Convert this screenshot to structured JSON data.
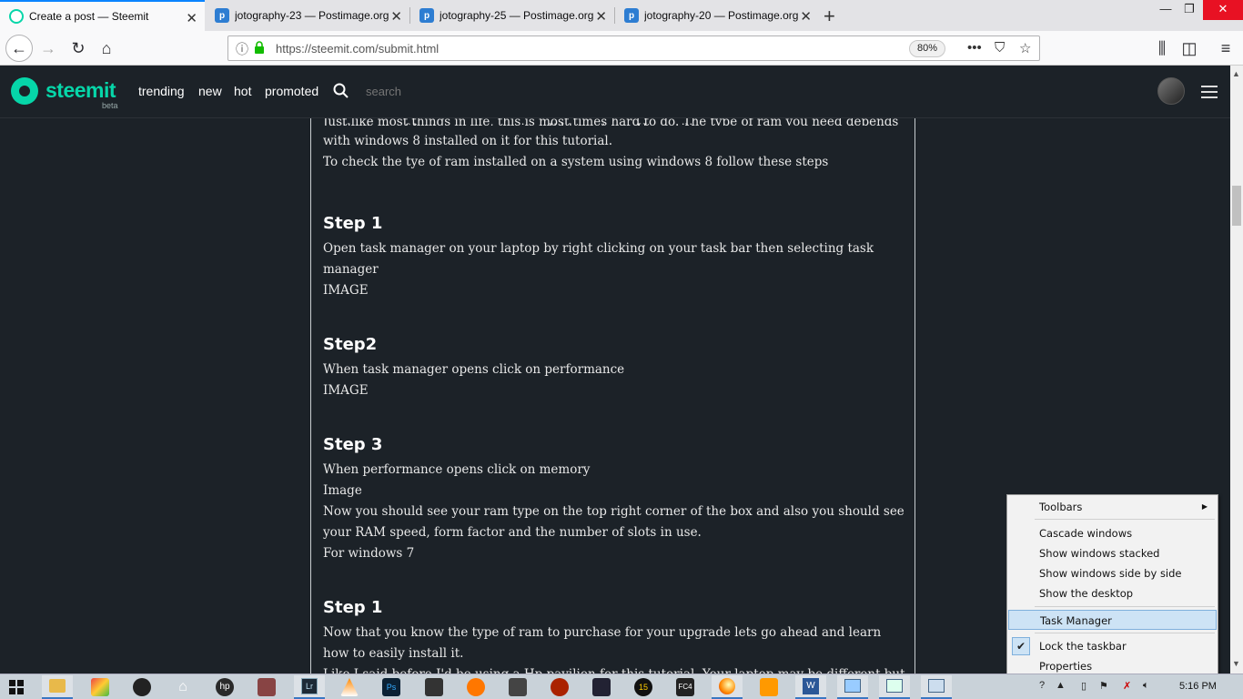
{
  "browser": {
    "tabs": [
      {
        "title": "Create a post — Steemit",
        "active": true,
        "favicon": "steemit-icon"
      },
      {
        "title": "jotography-23 — Postimage.org",
        "active": false,
        "favicon": "postimage-icon"
      },
      {
        "title": "jotography-25 — Postimage.org",
        "active": false,
        "favicon": "postimage-icon"
      },
      {
        "title": "jotography-20 — Postimage.org",
        "active": false,
        "favicon": "postimage-icon"
      }
    ],
    "url": "https://steemit.com/submit.html",
    "zoom": "80%"
  },
  "steemit": {
    "logo": "steemit",
    "beta": "beta",
    "nav": [
      "trending",
      "new",
      "hot",
      "promoted"
    ],
    "search_placeholder": "search"
  },
  "post": {
    "clipped_line": "Just like most things in life, this is most times hard to do. The type of ram you need depends on the type of laptop you are using. I'd be using a Hp pavilion",
    "intro": [
      "with windows 8 installed on it for this tutorial.",
      "To check the tye of ram installed on a system using windows 8 follow these steps"
    ],
    "sections": [
      {
        "heading": "Step 1",
        "lines": [
          "Open task manager on your laptop by right clicking on your task bar then selecting task manager",
          "IMAGE"
        ]
      },
      {
        "heading": "Step2",
        "lines": [
          "When task manager opens click on performance",
          "IMAGE"
        ]
      },
      {
        "heading": "Step 3",
        "lines": [
          "When performance opens click on memory",
          "Image",
          "Now you should see your ram type on the top right corner of the box and also you should see your RAM speed, form factor and the number of slots in use.",
          "For windows 7"
        ]
      },
      {
        "heading": "Step 1",
        "lines": [
          "Now that you know the type of ram to purchase for your upgrade lets go ahead and learn how to easily install it.",
          "Like I said before I'd be using a Hp pavilion for this tutorial. Your laptop may be different but the whole process of installing your RAM is the same. Just use discretion"
        ]
      }
    ]
  },
  "context_menu": {
    "toolbars": "Toolbars",
    "cascade": "Cascade windows",
    "stacked": "Show windows stacked",
    "side_by_side": "Show windows side by side",
    "desktop": "Show the desktop",
    "task_manager": "Task Manager",
    "lock": "Lock the taskbar",
    "properties": "Properties"
  },
  "taskbar": {
    "clock": "5:16 PM",
    "apps": [
      "file-explorer-icon",
      "lightroom-app-icon",
      "camera-app-icon",
      "home-icon",
      "hp-icon",
      "game-icon",
      "lightroom-icon",
      "vlc-icon",
      "photoshop-icon",
      "game2-icon",
      "uc-browser-icon",
      "game3-icon",
      "game4-icon",
      "game5-icon",
      "fifteen-icon",
      "fc4-icon",
      "firefox-icon",
      "media-player-icon",
      "word-icon",
      "window-icon",
      "control-panel-icon",
      "perf-icon"
    ]
  },
  "colors": {
    "accent": "#06d6a9",
    "page_bg": "#1c2228",
    "tab_accent": "#0a84ff"
  }
}
